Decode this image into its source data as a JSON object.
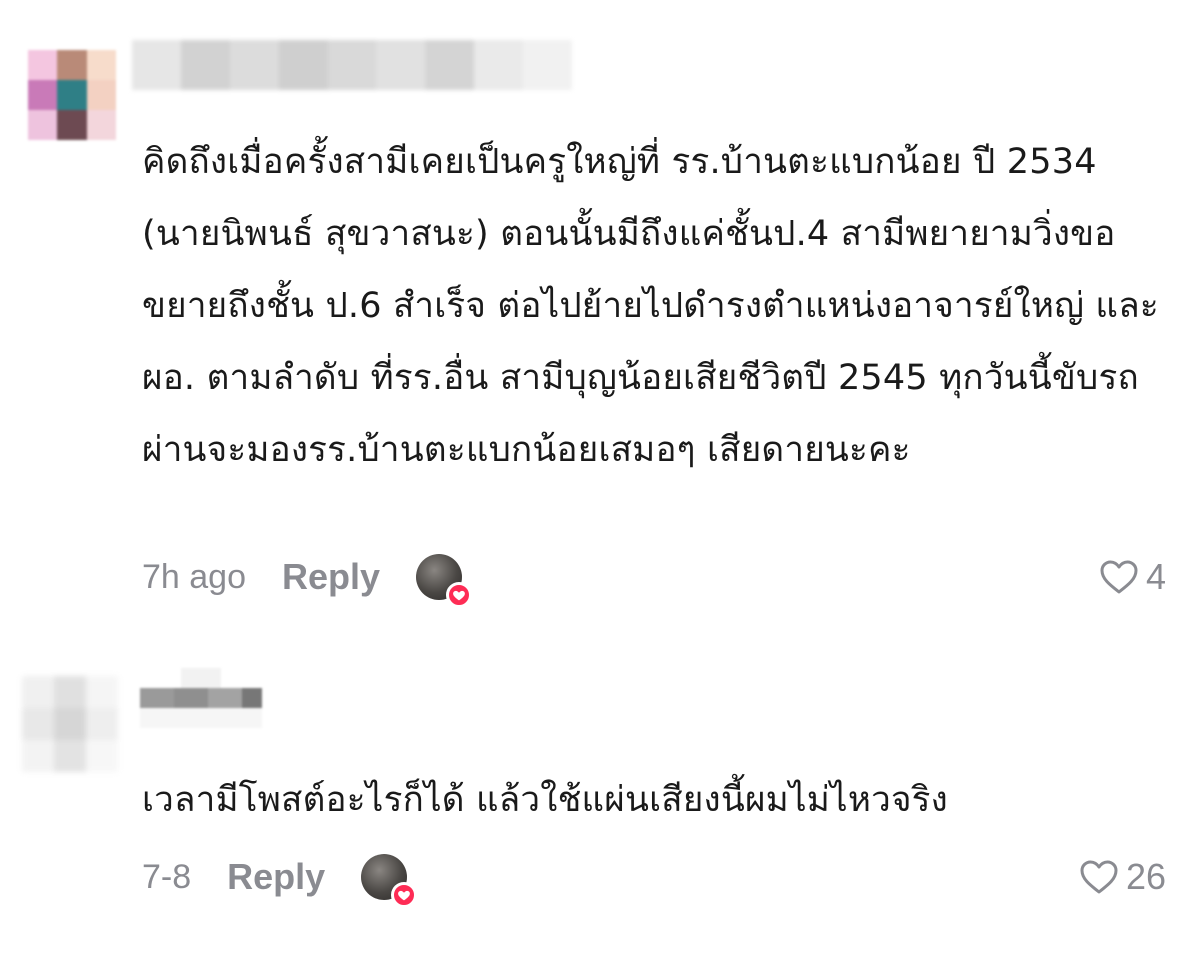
{
  "comments": [
    {
      "text": "คิดถึงเมื่อครั้งสามีเคยเป็นครูใหญ่ที่ รร.บ้านตะแบกน้อย ปี 2534 (นายนิพนธ์ สุขวาสนะ) ตอนนั้นมีถึงแค่ชั้นป.4 สามีพยายามวิ่งขอขยายถึงชั้น ป.6 สำเร็จ ต่อไปย้ายไปดำรงตำแหน่งอาจารย์ใหญ่ และผอ. ตามลำดับ ที่รร.อื่น สามีบุญน้อยเสียชีวิตปี 2545 ทุกวันนี้ขับรถผ่านจะมองรร.บ้านตะแบกน้อยเสมอๆ เสียดายนะคะ",
      "timestamp": "7h ago",
      "reply_label": "Reply",
      "like_count": "4",
      "creator_liked": true
    },
    {
      "text": "เวลามีโพสต์อะไรก็ได้ แล้วใช้แผ่นเสียงนี้ผมไม่ไหวจริง",
      "timestamp": "7-8",
      "reply_label": "Reply",
      "like_count": "26",
      "creator_liked": true
    }
  ],
  "colors": {
    "meta_text": "#8a8b91",
    "body_text": "#1a1a1a",
    "liked_badge": "#fe2c55"
  },
  "icons": {
    "like": "heart-outline-icon",
    "creator_liked": "heart-filled-icon"
  }
}
